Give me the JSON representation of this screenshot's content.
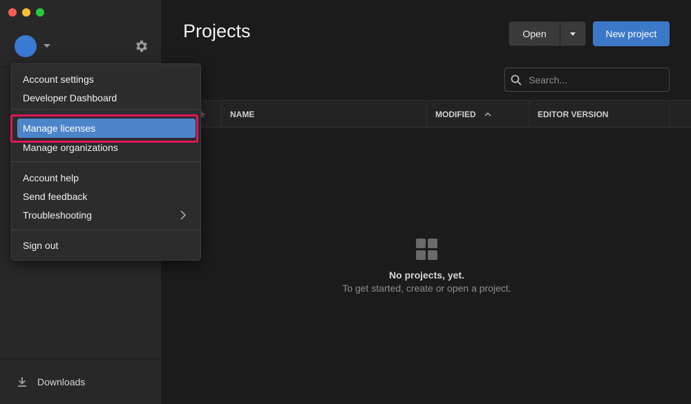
{
  "window": {
    "controls": [
      "close",
      "minimize",
      "maximize"
    ]
  },
  "sidebar": {
    "avatar_color": "#3a7bd5",
    "settings_icon": "gear-icon",
    "downloads_label": "Downloads",
    "downloads_icon": "download-icon"
  },
  "header": {
    "title": "Projects",
    "open_label": "Open",
    "new_project_label": "New project",
    "accent": "#3c78c8"
  },
  "search": {
    "placeholder": "Search..."
  },
  "table": {
    "columns": [
      "NAME",
      "MODIFIED",
      "EDITOR VERSION"
    ],
    "sort_column": "MODIFIED",
    "sort_direction": "ascending"
  },
  "empty_state": {
    "title": "No projects, yet.",
    "subtitle": "To get started, create or open a project."
  },
  "account_menu": {
    "items": [
      {
        "label": "Account settings"
      },
      {
        "label": "Developer Dashboard"
      },
      {
        "label": "Manage licenses",
        "highlighted": true
      },
      {
        "label": "Manage organizations"
      },
      {
        "label": "Account help"
      },
      {
        "label": "Send feedback"
      },
      {
        "label": "Troubleshooting",
        "submenu": true
      },
      {
        "label": "Sign out"
      }
    ],
    "highlight_color": "#4b84c9",
    "annotation_frame_color": "#e0155d"
  }
}
